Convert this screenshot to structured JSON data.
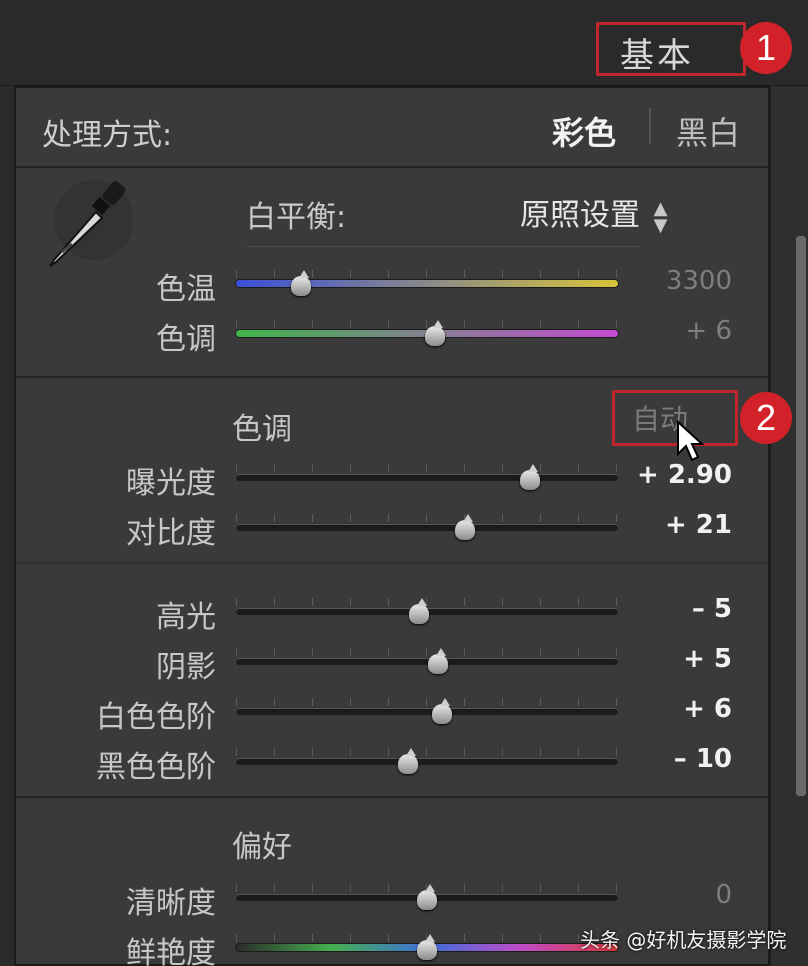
{
  "panel": {
    "title": "基本",
    "annotations": {
      "marker1": "1",
      "marker2": "2"
    }
  },
  "treatment": {
    "label": "处理方式:",
    "color_option": "彩色",
    "bw_option": "黑白",
    "selected": "彩色"
  },
  "white_balance": {
    "label": "白平衡:",
    "value": "原照设置",
    "arrows": "▲▼",
    "sliders": [
      {
        "id": "temp",
        "label": "色温",
        "value_text": "3300",
        "position": 0.17,
        "gradient": [
          "#3b4fd8",
          "#d8c43a"
        ],
        "value_color": "#7e7e7e"
      },
      {
        "id": "tint",
        "label": "色调",
        "value_text": "+ 6",
        "position": 0.52,
        "gradient": [
          "#3fb54a",
          "#c64bd4"
        ],
        "value_color": "#7e7e7e"
      }
    ]
  },
  "tone": {
    "header": "色调",
    "auto_label": "自动",
    "primary": [
      {
        "id": "exposure",
        "label": "曝光度",
        "value_text": "+ 2.90",
        "position": 0.77
      },
      {
        "id": "contrast",
        "label": "对比度",
        "value_text": "+ 21",
        "position": 0.6
      }
    ],
    "secondary": [
      {
        "id": "highlights",
        "label": "高光",
        "value_text": "– 5",
        "position": 0.48
      },
      {
        "id": "shadows",
        "label": "阴影",
        "value_text": "+ 5",
        "position": 0.53
      },
      {
        "id": "whites",
        "label": "白色色阶",
        "value_text": "+ 6",
        "position": 0.54
      },
      {
        "id": "blacks",
        "label": "黑色色阶",
        "value_text": "– 10",
        "position": 0.45
      }
    ]
  },
  "presence": {
    "header": "偏好",
    "sliders": [
      {
        "id": "clarity",
        "label": "清晰度",
        "value_text": "0",
        "position": 0.5,
        "value_color": "#7e7e7e"
      },
      {
        "id": "vibrance",
        "label": "鲜艳度",
        "value_text": "",
        "position": 0.5,
        "gradient": [
          "#2b2b2b",
          "#46b04f",
          "#3d6fd9",
          "#c24bc8",
          "#d63a3a"
        ]
      }
    ]
  },
  "watermark": "头条 @好机友摄影学院",
  "colors": {
    "accent_red": "#c0262b",
    "value_bright": "#f1f1f1",
    "value_dim": "#7e7e7e"
  }
}
